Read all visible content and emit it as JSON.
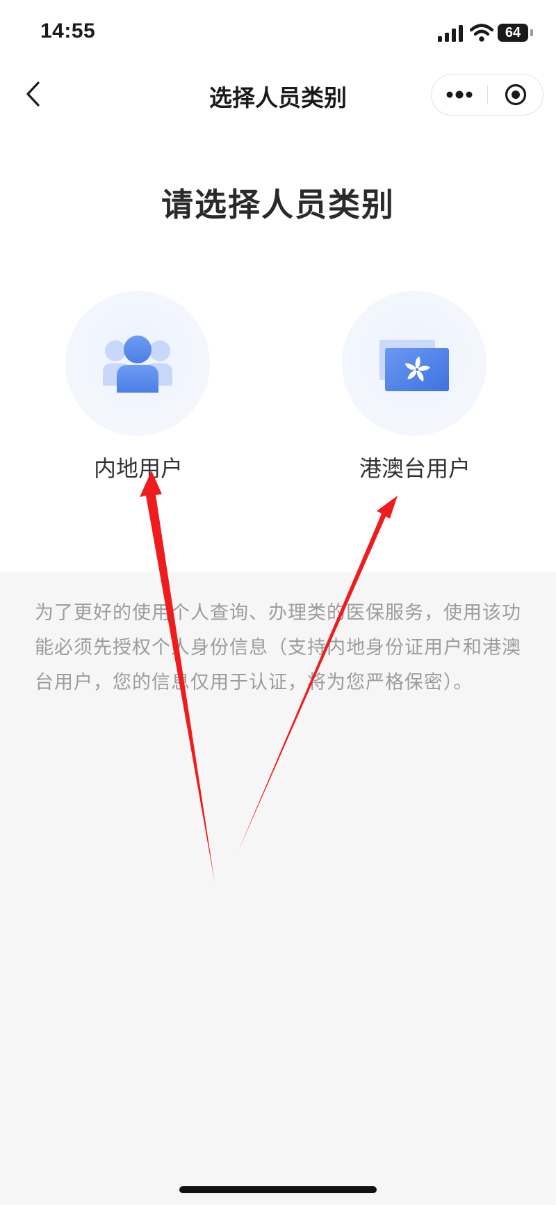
{
  "status_bar": {
    "time": "14:55",
    "battery": "64",
    "icons": [
      "signal-icon",
      "wifi-icon",
      "battery-icon"
    ]
  },
  "nav": {
    "title": "选择人员类别",
    "back_icon": "chevron-left-icon",
    "more_icon": "more-dots-icon",
    "close_icon": "target-close-icon"
  },
  "heading": "请选择人员类别",
  "options": [
    {
      "label": "内地用户",
      "icon": "users-icon"
    },
    {
      "label": "港澳台用户",
      "icon": "hk-flag-card-icon"
    }
  ],
  "notice_text": "为了更好的使用个人查询、办理类的医保服务，使用该功能必须先授权个人身份信息（支持内地身份证用户和港澳台用户，您的信息仅用于认证，将为您严格保密）。",
  "colors": {
    "accent_blue": "#5b8def",
    "annotation_red": "#ee1c1c",
    "lower_background": "#f6f6f6"
  }
}
